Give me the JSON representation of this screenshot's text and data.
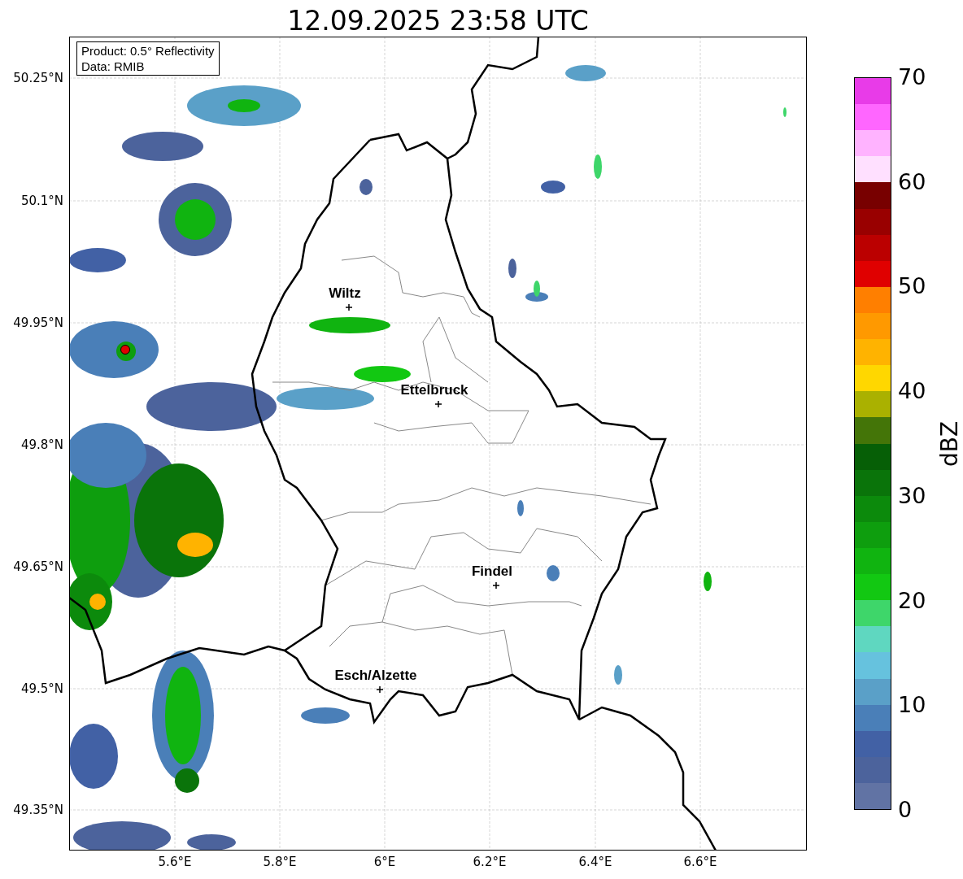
{
  "title": "12.09.2025 23:58 UTC",
  "info_box": [
    "Product: 0.5° Reflectivity",
    "Data: RMIB"
  ],
  "y_ticks": [
    "50.25°N",
    "50.1°N",
    "49.95°N",
    "49.8°N",
    "49.65°N",
    "49.5°N",
    "49.35°N"
  ],
  "x_ticks": [
    "5.6°E",
    "5.8°E",
    "6°E",
    "6.2°E",
    "6.4°E",
    "6.6°E"
  ],
  "cities": [
    {
      "name": "Wiltz"
    },
    {
      "name": "Ettelbruck"
    },
    {
      "name": "Findel"
    },
    {
      "name": "Esch/Alzette"
    }
  ],
  "colorbar": {
    "label": "dBZ",
    "ticks": [
      "70",
      "60",
      "50",
      "40",
      "30",
      "20",
      "10",
      "0"
    ],
    "bands": [
      {
        "color": "#e83be8"
      },
      {
        "color": "#ff66ff"
      },
      {
        "color": "#ffb3ff"
      },
      {
        "color": "#ffe0ff"
      },
      {
        "color": "#780000"
      },
      {
        "color": "#990000"
      },
      {
        "color": "#bb0000"
      },
      {
        "color": "#e00000"
      },
      {
        "color": "#ff7f00"
      },
      {
        "color": "#ff9900"
      },
      {
        "color": "#ffb300"
      },
      {
        "color": "#ffd700"
      },
      {
        "color": "#aab100"
      },
      {
        "color": "#447508"
      },
      {
        "color": "#065f06"
      },
      {
        "color": "#0a740a"
      },
      {
        "color": "#0c8a0c"
      },
      {
        "color": "#0e9e0e"
      },
      {
        "color": "#10b410"
      },
      {
        "color": "#12c812"
      },
      {
        "color": "#3ed66a"
      },
      {
        "color": "#5fd7c0"
      },
      {
        "color": "#66c2de"
      },
      {
        "color": "#5aa0c8"
      },
      {
        "color": "#4a7fb8"
      },
      {
        "color": "#4261a5"
      },
      {
        "color": "#4c639c"
      },
      {
        "color": "#6173a4"
      }
    ]
  }
}
